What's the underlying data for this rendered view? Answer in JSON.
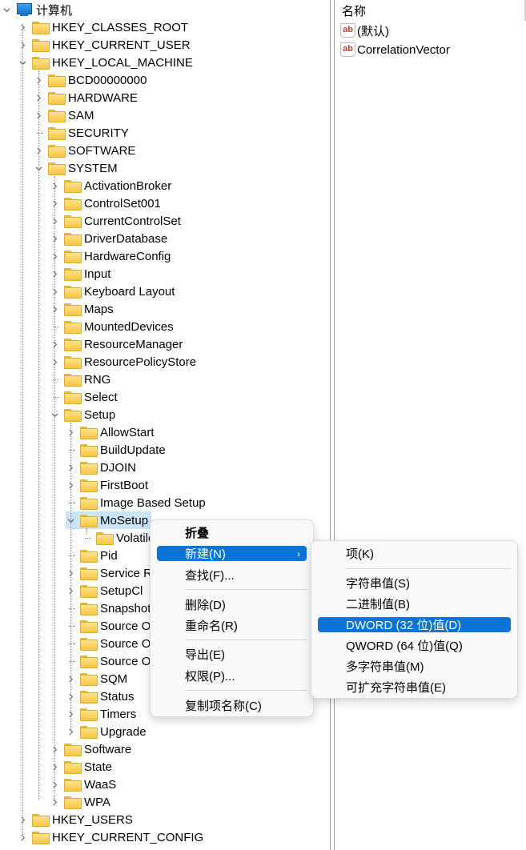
{
  "tree": {
    "root": {
      "label": "计算机",
      "icon": "computer-icon"
    },
    "nodes": [
      {
        "label": "HKEY_CLASSES_ROOT",
        "level": 1,
        "expander": "collapsed"
      },
      {
        "label": "HKEY_CURRENT_USER",
        "level": 1,
        "expander": "collapsed"
      },
      {
        "label": "HKEY_LOCAL_MACHINE",
        "level": 1,
        "expander": "expanded"
      },
      {
        "label": "BCD00000000",
        "level": 2,
        "expander": "collapsed"
      },
      {
        "label": "HARDWARE",
        "level": 2,
        "expander": "collapsed"
      },
      {
        "label": "SAM",
        "level": 2,
        "expander": "collapsed"
      },
      {
        "label": "SECURITY",
        "level": 2,
        "expander": "none"
      },
      {
        "label": "SOFTWARE",
        "level": 2,
        "expander": "collapsed"
      },
      {
        "label": "SYSTEM",
        "level": 2,
        "expander": "expanded"
      },
      {
        "label": "ActivationBroker",
        "level": 3,
        "expander": "collapsed"
      },
      {
        "label": "ControlSet001",
        "level": 3,
        "expander": "collapsed"
      },
      {
        "label": "CurrentControlSet",
        "level": 3,
        "expander": "collapsed"
      },
      {
        "label": "DriverDatabase",
        "level": 3,
        "expander": "collapsed"
      },
      {
        "label": "HardwareConfig",
        "level": 3,
        "expander": "collapsed"
      },
      {
        "label": "Input",
        "level": 3,
        "expander": "collapsed"
      },
      {
        "label": "Keyboard Layout",
        "level": 3,
        "expander": "collapsed"
      },
      {
        "label": "Maps",
        "level": 3,
        "expander": "collapsed"
      },
      {
        "label": "MountedDevices",
        "level": 3,
        "expander": "none"
      },
      {
        "label": "ResourceManager",
        "level": 3,
        "expander": "collapsed"
      },
      {
        "label": "ResourcePolicyStore",
        "level": 3,
        "expander": "collapsed"
      },
      {
        "label": "RNG",
        "level": 3,
        "expander": "none"
      },
      {
        "label": "Select",
        "level": 3,
        "expander": "none"
      },
      {
        "label": "Setup",
        "level": 3,
        "expander": "expanded"
      },
      {
        "label": "AllowStart",
        "level": 4,
        "expander": "collapsed"
      },
      {
        "label": "BuildUpdate",
        "level": 4,
        "expander": "none"
      },
      {
        "label": "DJOIN",
        "level": 4,
        "expander": "collapsed"
      },
      {
        "label": "FirstBoot",
        "level": 4,
        "expander": "collapsed"
      },
      {
        "label": "Image Based Setup",
        "level": 4,
        "expander": "none"
      },
      {
        "label": "MoSetup",
        "level": 4,
        "expander": "expanded",
        "selected": true
      },
      {
        "label": "Volatile",
        "level": 5,
        "expander": "none"
      },
      {
        "label": "Pid",
        "level": 4,
        "expander": "none"
      },
      {
        "label": "Service Reporting API",
        "level": 4,
        "expander": "collapsed"
      },
      {
        "label": "SetupCl",
        "level": 4,
        "expander": "collapsed"
      },
      {
        "label": "Snapshot",
        "level": 4,
        "expander": "none"
      },
      {
        "label": "Source OS",
        "level": 4,
        "expander": "none"
      },
      {
        "label": "Source OS",
        "level": 4,
        "expander": "none"
      },
      {
        "label": "Source OS",
        "level": 4,
        "expander": "none"
      },
      {
        "label": "SQM",
        "level": 4,
        "expander": "collapsed"
      },
      {
        "label": "Status",
        "level": 4,
        "expander": "collapsed"
      },
      {
        "label": "Timers",
        "level": 4,
        "expander": "collapsed"
      },
      {
        "label": "Upgrade",
        "level": 4,
        "expander": "collapsed"
      },
      {
        "label": "Software",
        "level": 3,
        "expander": "collapsed"
      },
      {
        "label": "State",
        "level": 3,
        "expander": "collapsed"
      },
      {
        "label": "WaaS",
        "level": 3,
        "expander": "collapsed"
      },
      {
        "label": "WPA",
        "level": 3,
        "expander": "collapsed"
      },
      {
        "label": "HKEY_USERS",
        "level": 1,
        "expander": "collapsed"
      },
      {
        "label": "HKEY_CURRENT_CONFIG",
        "level": 1,
        "expander": "collapsed"
      }
    ]
  },
  "values_pane": {
    "column_header": "名称",
    "rows": [
      {
        "name": "(默认)",
        "icon": "string-value-icon",
        "icon_text": "ab"
      },
      {
        "name": "CorrelationVector",
        "icon": "string-value-icon",
        "icon_text": "ab"
      }
    ]
  },
  "context_menu": {
    "items": [
      {
        "label": "折叠",
        "bold": true
      },
      {
        "label": "新建(N)",
        "submenu": true,
        "highlighted": true
      },
      {
        "label": "查找(F)..."
      },
      {
        "separator": true
      },
      {
        "label": "删除(D)"
      },
      {
        "label": "重命名(R)"
      },
      {
        "separator": true
      },
      {
        "label": "导出(E)"
      },
      {
        "label": "权限(P)..."
      },
      {
        "separator": true
      },
      {
        "label": "复制项名称(C)"
      }
    ],
    "submenu_arrow": "›"
  },
  "new_submenu": {
    "items": [
      {
        "label": "项(K)"
      },
      {
        "separator": true
      },
      {
        "label": "字符串值(S)"
      },
      {
        "label": "二进制值(B)"
      },
      {
        "label": "DWORD (32 位)值(D)",
        "highlighted": true
      },
      {
        "label": "QWORD (64 位)值(Q)"
      },
      {
        "label": "多字符串值(M)"
      },
      {
        "label": "可扩充字符串值(E)"
      }
    ]
  },
  "colors": {
    "highlight": "#0a74d6",
    "selection": "#cce4f7"
  }
}
